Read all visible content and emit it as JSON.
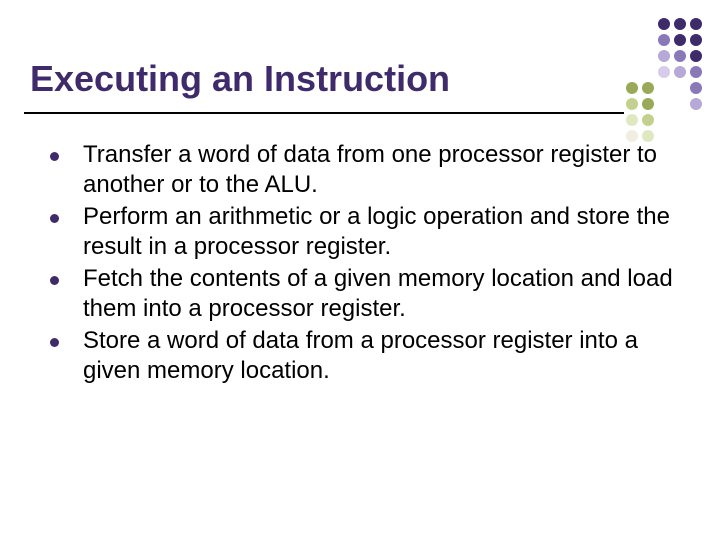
{
  "title": "Executing an Instruction",
  "bullets": [
    "Transfer a word of data from one processor register to another or to the ALU.",
    "Perform an arithmetic or a logic operation and store the result in a processor register.",
    "Fetch the contents of a given memory location and load them into a processor register.",
    "Store a word of data from a processor register into a given memory location."
  ]
}
